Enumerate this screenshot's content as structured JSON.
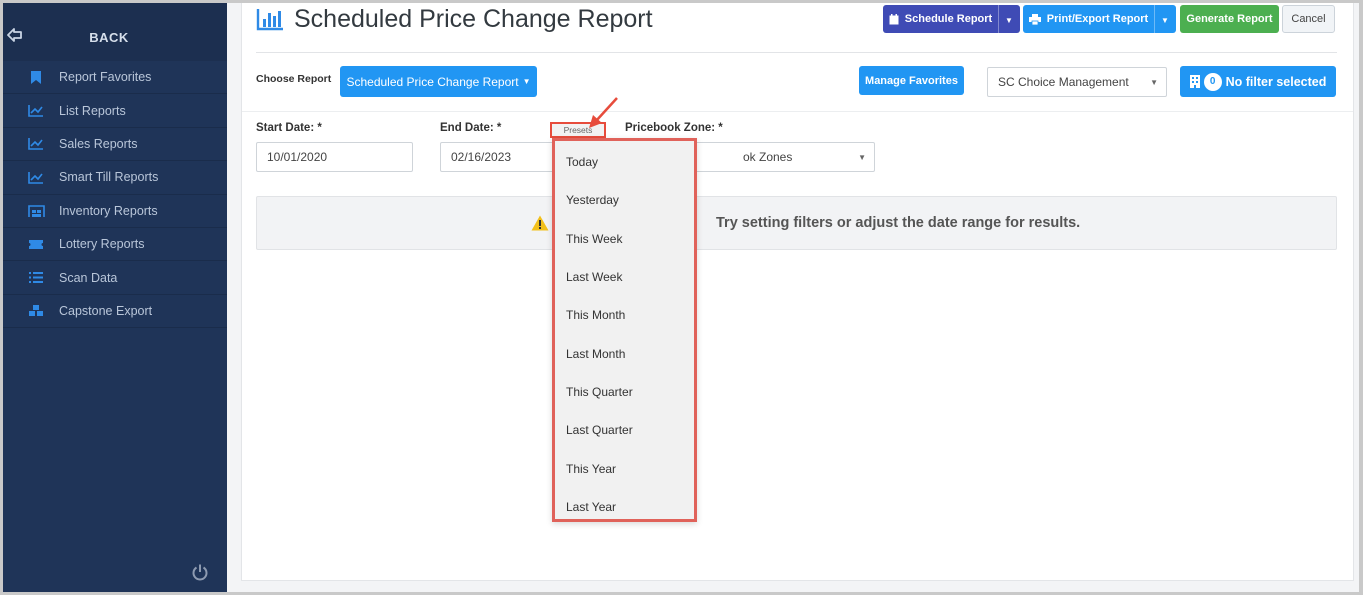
{
  "sidebar": {
    "back_label": "BACK",
    "items": [
      {
        "label": "Report Favorites",
        "icon": "bookmark-icon"
      },
      {
        "label": "List Reports",
        "icon": "line-chart-icon"
      },
      {
        "label": "Sales Reports",
        "icon": "line-chart-icon"
      },
      {
        "label": "Smart Till Reports",
        "icon": "line-chart-icon"
      },
      {
        "label": "Inventory Reports",
        "icon": "warehouse-icon"
      },
      {
        "label": "Lottery Reports",
        "icon": "ticket-icon"
      },
      {
        "label": "Scan Data",
        "icon": "list-icon"
      },
      {
        "label": "Capstone Export",
        "icon": "cubes-icon"
      }
    ]
  },
  "header": {
    "title": "Scheduled Price Change Report",
    "schedule_label": "Schedule Report",
    "print_label": "Print/Export Report",
    "generate_label": "Generate Report",
    "cancel_label": "Cancel"
  },
  "filters": {
    "choose_report_label": "Choose Report",
    "choose_report_value": "Scheduled Price Change Report",
    "manage_favorites_label": "Manage Favorites",
    "store_value": "SC Choice Management",
    "filter_count": "0",
    "filter_label": "No filter selected",
    "start_date_label": "Start Date: *",
    "start_date_value": "10/01/2020",
    "end_date_label": "End Date: *",
    "end_date_value": "02/16/2023",
    "presets_label": "Presets",
    "zone_label": "Pricebook Zone: *",
    "zone_value": "ok Zones"
  },
  "alert": {
    "text": "Try setting filters or adjust the date range for results."
  },
  "presets": {
    "options": [
      "Today",
      "Yesterday",
      "This Week",
      "Last Week",
      "This Month",
      "Last Month",
      "This Quarter",
      "Last Quarter",
      "This Year",
      "Last Year"
    ]
  },
  "colors": {
    "sidebar_bg": "#1f3458",
    "primary": "#2196f3",
    "indigo": "#3f4bb5",
    "success": "#4caf50",
    "highlight": "#e74c3c"
  }
}
